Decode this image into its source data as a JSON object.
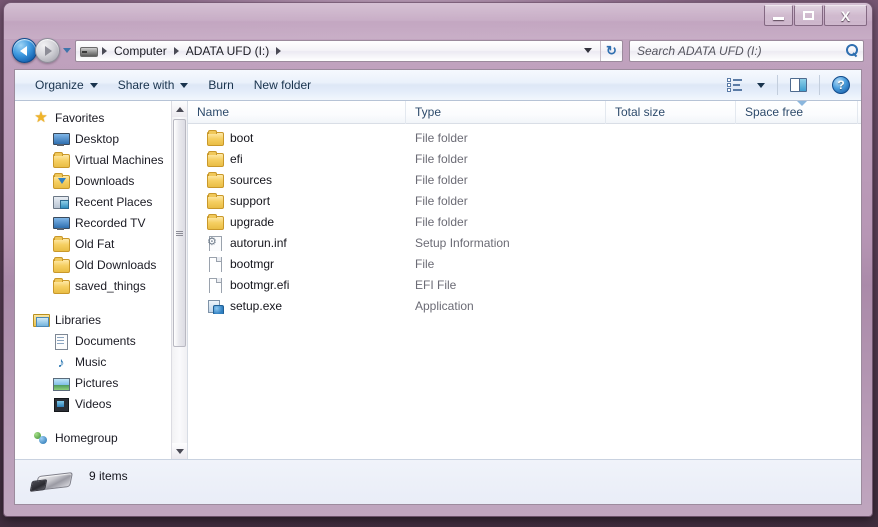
{
  "window": {
    "title": "",
    "controls": {
      "minimize_label": "Minimize",
      "maximize_label": "Maximize",
      "close_label": "X"
    }
  },
  "navigation": {
    "back_label": "Back",
    "forward_label": "Forward",
    "history_label": "Recent pages",
    "refresh_label": "↻",
    "breadcrumbs": [
      {
        "label": "Computer"
      },
      {
        "label": "ADATA UFD (I:)"
      }
    ]
  },
  "search": {
    "placeholder": "Search ADATA UFD (I:)",
    "value": "",
    "icon": "search-icon"
  },
  "toolbar": {
    "organize_label": "Organize",
    "share_with_label": "Share with",
    "burn_label": "Burn",
    "new_folder_label": "New folder",
    "views_icon": "views-list-icon",
    "preview_pane_icon": "preview-pane-icon",
    "help_label": "?"
  },
  "sidebar": {
    "sections": [
      {
        "name": "Favorites",
        "icon": "star-icon",
        "items": [
          {
            "label": "Desktop",
            "icon": "monitor-icon"
          },
          {
            "label": "Virtual Machines",
            "icon": "folder-icon"
          },
          {
            "label": "Downloads",
            "icon": "downloads-folder-icon"
          },
          {
            "label": "Recent Places",
            "icon": "recent-places-icon"
          },
          {
            "label": "Recorded TV",
            "icon": "monitor-icon"
          },
          {
            "label": "Old Fat",
            "icon": "folder-icon"
          },
          {
            "label": "Old Downloads",
            "icon": "folder-icon"
          },
          {
            "label": "saved_things",
            "icon": "folder-icon"
          }
        ]
      },
      {
        "name": "Libraries",
        "icon": "library-icon",
        "items": [
          {
            "label": "Documents",
            "icon": "document-icon"
          },
          {
            "label": "Music",
            "icon": "music-note-icon"
          },
          {
            "label": "Pictures",
            "icon": "picture-icon"
          },
          {
            "label": "Videos",
            "icon": "video-icon"
          }
        ]
      },
      {
        "name": "Homegroup",
        "icon": "homegroup-icon",
        "items": []
      }
    ],
    "scrollbar": {
      "up_label": "Scroll up",
      "down_label": "Scroll down"
    }
  },
  "filelist": {
    "columns": [
      {
        "key": "name",
        "label": "Name",
        "sorted": false
      },
      {
        "key": "type",
        "label": "Type",
        "sorted": false
      },
      {
        "key": "total",
        "label": "Total size",
        "sorted": false
      },
      {
        "key": "free",
        "label": "Space free",
        "sorted": true
      }
    ],
    "rows": [
      {
        "name": "boot",
        "type": "File folder",
        "total": "",
        "free": "",
        "icon": "folder-icon"
      },
      {
        "name": "efi",
        "type": "File folder",
        "total": "",
        "free": "",
        "icon": "folder-icon"
      },
      {
        "name": "sources",
        "type": "File folder",
        "total": "",
        "free": "",
        "icon": "folder-icon"
      },
      {
        "name": "support",
        "type": "File folder",
        "total": "",
        "free": "",
        "icon": "folder-icon"
      },
      {
        "name": "upgrade",
        "type": "File folder",
        "total": "",
        "free": "",
        "icon": "folder-icon"
      },
      {
        "name": "autorun.inf",
        "type": "Setup Information",
        "total": "",
        "free": "",
        "icon": "setup-information-icon"
      },
      {
        "name": "bootmgr",
        "type": "File",
        "total": "",
        "free": "",
        "icon": "generic-file-icon"
      },
      {
        "name": "bootmgr.efi",
        "type": "EFI File",
        "total": "",
        "free": "",
        "icon": "generic-file-icon"
      },
      {
        "name": "setup.exe",
        "type": "Application",
        "total": "",
        "free": "",
        "icon": "application-icon"
      }
    ]
  },
  "statusbar": {
    "item_count": "9 items",
    "drive_icon": "usb-drive-icon"
  },
  "colors": {
    "frame": "#bb9aba",
    "accent": "#2f6fb0",
    "folder": "#f0c85a",
    "column_header_text": "#2d4a6b"
  }
}
